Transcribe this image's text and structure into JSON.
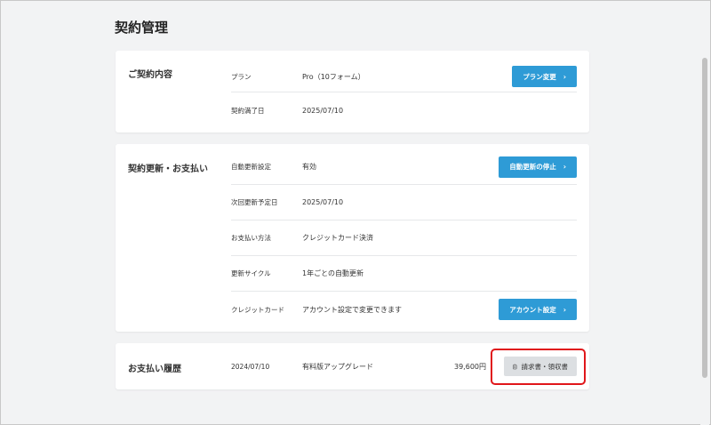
{
  "page": {
    "title": "契約管理"
  },
  "contract": {
    "title": "ご契約内容",
    "rows": [
      {
        "label": "プラン",
        "value": "Pro（10フォーム）"
      },
      {
        "label": "契約満了日",
        "value": "2025/07/10"
      }
    ],
    "button": {
      "label": "プラン変更",
      "chevron": "›"
    }
  },
  "renewal": {
    "title": "契約更新・お支払い",
    "rows": [
      {
        "label": "自動更新設定",
        "value": "有効"
      },
      {
        "label": "次回更新予定日",
        "value": "2025/07/10"
      },
      {
        "label": "お支払い方法",
        "value": "クレジットカード決済"
      },
      {
        "label": "更新サイクル",
        "value": "1年ごとの自動更新"
      },
      {
        "label": "クレジットカード",
        "value": "アカウント設定で変更できます"
      }
    ],
    "stop_button": {
      "label": "自動更新の停止",
      "chevron": "›"
    },
    "account_button": {
      "label": "アカウント設定",
      "chevron": "›"
    }
  },
  "history": {
    "title": "お支払い履歴",
    "entries": [
      {
        "date": "2024/07/10",
        "description": "有料版アップグレード",
        "amount": "39,600円"
      }
    ],
    "invoice_button": {
      "label": "請求書・領収書",
      "icon": "clipboard-icon"
    }
  },
  "colors": {
    "primary": "#2e9bd6",
    "highlight": "#e0171b",
    "background": "#f2f3f4"
  }
}
